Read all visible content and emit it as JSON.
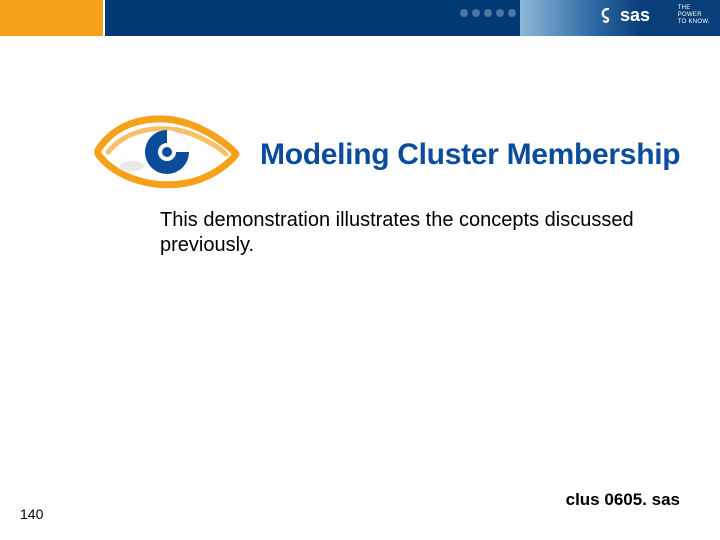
{
  "header": {
    "brand": "sas",
    "tagline_line1": "THE",
    "tagline_line2": "POWER",
    "tagline_line3": "TO KNOW."
  },
  "title": "Modeling Cluster Membership",
  "body": "This demonstration illustrates the concepts discussed previously.",
  "page_number": "140",
  "filename": "clus 0605. sas"
}
